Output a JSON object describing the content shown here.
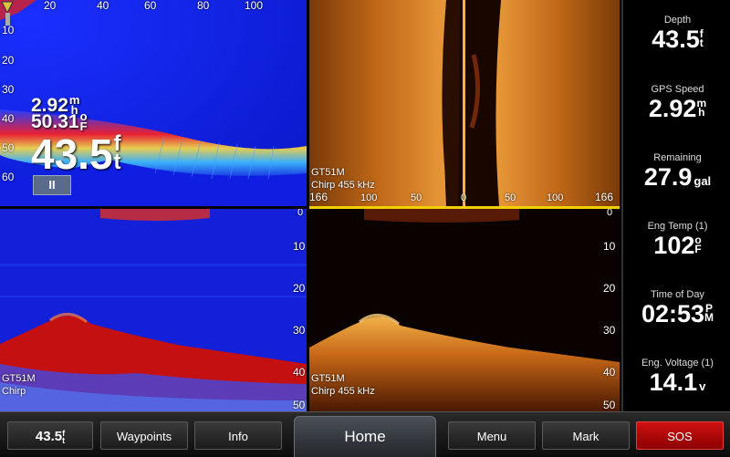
{
  "panes": {
    "traditional": {
      "range_ticks": [
        "20",
        "40",
        "60",
        "80",
        "100"
      ],
      "depth_ticks": [
        "10",
        "20",
        "30",
        "40",
        "50",
        "60"
      ],
      "speed_value": "2.92",
      "speed_unit": [
        "m",
        "h"
      ],
      "temp_value": "50.31",
      "temp_unit": [
        "o",
        "F"
      ],
      "depth_value": "43.5",
      "depth_unit": [
        "f",
        "t"
      ],
      "pause_label": "II"
    },
    "sidevu": {
      "model": "GT51M",
      "mode": "Chirp 455 kHz",
      "scale_ticks": [
        "166",
        "100",
        "50",
        "0",
        "50",
        "100",
        "166"
      ]
    },
    "downvu_chirp": {
      "model": "GT51M",
      "mode": "Chirp",
      "depth_ticks": [
        "0",
        "10",
        "20",
        "30",
        "40",
        "50"
      ]
    },
    "downvu": {
      "model": "GT51M",
      "mode": "Chirp 455 kHz",
      "depth_ticks": [
        "0",
        "10",
        "20",
        "30",
        "40",
        "50"
      ]
    }
  },
  "data_panel": [
    {
      "label": "Depth",
      "value": "43.5",
      "unit": [
        "f",
        "t"
      ]
    },
    {
      "label": "GPS Speed",
      "value": "2.92",
      "unit": [
        "m",
        "h"
      ]
    },
    {
      "label": "Remaining",
      "value": "27.9",
      "unit_inline": "gal"
    },
    {
      "label": "Eng Temp (1)",
      "value": "102",
      "unit": [
        "o",
        "F"
      ]
    },
    {
      "label": "Time of Day",
      "value": "02:53",
      "unit": [
        "P",
        "M"
      ]
    },
    {
      "label": "Eng. Voltage (1)",
      "value": "14.1",
      "unit_inline": "v"
    }
  ],
  "bottom_bar": {
    "depth_value": "43.5",
    "depth_unit": [
      "f",
      "t"
    ],
    "waypoints": "Waypoints",
    "info": "Info",
    "home": "Home",
    "menu": "Menu",
    "mark": "Mark",
    "sos": "SOS"
  },
  "colors": {
    "sonar_water": "#1020e0",
    "sonar_bottom": "#b01010",
    "amber_bottom": "#e8a030",
    "sos": "#c00000",
    "divider": "#f0d000"
  }
}
